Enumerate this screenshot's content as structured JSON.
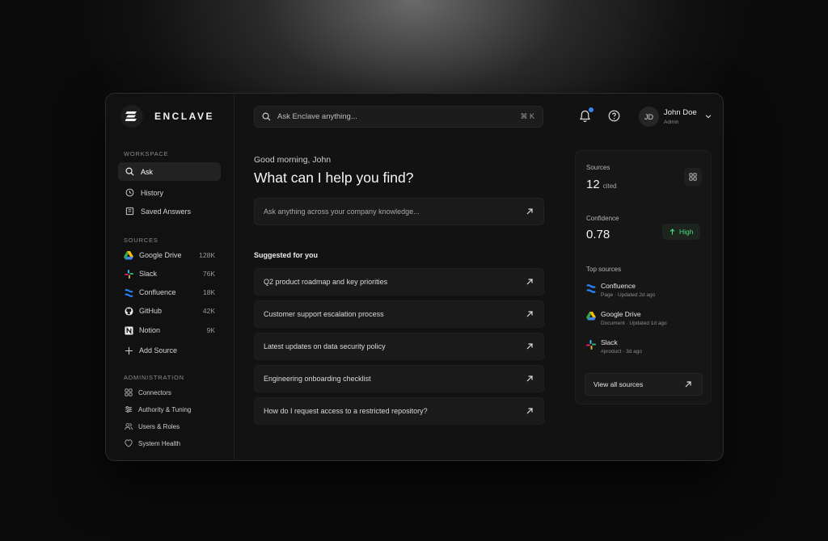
{
  "app": {
    "name": "ENCLAVE"
  },
  "search": {
    "placeholder": "Ask Enclave anything...",
    "shortcut": "⌘ K"
  },
  "user": {
    "initials": "JD",
    "name": "John Doe",
    "role": "Admin"
  },
  "notifications": {
    "badge_color": "#3b82f6"
  },
  "sidebar": {
    "workspace_title": "WORKSPACE",
    "workspace_items": [
      {
        "label": "Ask",
        "icon": "search-icon",
        "active": true
      },
      {
        "label": "History",
        "icon": "history-icon"
      },
      {
        "label": "Saved Answers",
        "icon": "bookmark-icon"
      }
    ],
    "sources_title": "SOURCES",
    "sources": [
      {
        "label": "Google Drive",
        "count": "128K",
        "icon": "google-drive-icon"
      },
      {
        "label": "Slack",
        "count": "76K",
        "icon": "slack-icon"
      },
      {
        "label": "Confluence",
        "count": "18K",
        "icon": "confluence-icon"
      },
      {
        "label": "GitHub",
        "count": "42K",
        "icon": "github-icon"
      },
      {
        "label": "Notion",
        "count": "9K",
        "icon": "notion-icon"
      }
    ],
    "add_source": "Add Source",
    "admin_title": "ADMINISTRATION",
    "admin_items": [
      {
        "label": "Connectors",
        "icon": "connectors-icon"
      },
      {
        "label": "Authority & Tuning",
        "icon": "sliders-icon"
      },
      {
        "label": "Users & Roles",
        "icon": "users-icon"
      },
      {
        "label": "System Health",
        "icon": "health-icon"
      }
    ]
  },
  "main": {
    "greeting": "Good morning, John",
    "headline": "What can I help you find?",
    "ask_placeholder": "Ask anything across your company knowledge...",
    "suggested_title": "Suggested for you",
    "suggestions": [
      "Q2 product roadmap and key priorities",
      "Customer support escalation process",
      "Latest updates on data security policy",
      "Engineering onboarding checklist",
      "How do I request access to a restricted repository?"
    ]
  },
  "panel": {
    "sources_label": "Sources",
    "sources_count": "12",
    "sources_suffix": "cited",
    "confidence_label": "Confidence",
    "confidence_value": "0.78",
    "confidence_badge": "High",
    "top_sources_label": "Top sources",
    "top_sources": [
      {
        "name": "Confluence",
        "meta": "Page · Updated 2d ago",
        "icon": "confluence-icon"
      },
      {
        "name": "Google Drive",
        "meta": "Document · Updated 1d ago",
        "icon": "google-drive-icon"
      },
      {
        "name": "Slack",
        "meta": "#product · 3d ago",
        "icon": "slack-icon"
      }
    ],
    "view_all": "View all sources"
  }
}
